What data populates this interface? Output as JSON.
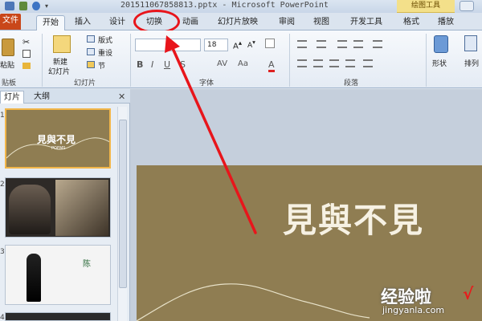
{
  "window": {
    "title": "201511067858813.pptx - Microsoft PowerPoint",
    "context_tool_title": "绘图工具"
  },
  "tabs": [
    {
      "label": "文件"
    },
    {
      "label": "开始"
    },
    {
      "label": "插入"
    },
    {
      "label": "设计"
    },
    {
      "label": "切换"
    },
    {
      "label": "动画"
    },
    {
      "label": "幻灯片放映"
    },
    {
      "label": "审阅"
    },
    {
      "label": "视图"
    },
    {
      "label": "开发工具"
    },
    {
      "label": "格式"
    },
    {
      "label": "播放"
    }
  ],
  "ribbon": {
    "clipboard": {
      "paste_label": "粘贴",
      "group_label": "贴板"
    },
    "slides": {
      "new_slide_label": "新建",
      "new_slide_sub": "幻灯片",
      "layout_label": "版式",
      "reset_label": "重设",
      "section_label": "节",
      "group_label": "幻灯片"
    },
    "font": {
      "font_size": "18",
      "group_label": "字体"
    },
    "paragraph": {
      "group_label": "段落"
    },
    "drawing": {
      "shape_label": "形状",
      "arrange_label": "排列"
    }
  },
  "pane": {
    "tab_slides": "灯片",
    "tab_outline": "大纲",
    "thumbnails": [
      {
        "number": "1",
        "title": "見與不見",
        "subtitle": "POEMS"
      },
      {
        "number": "2"
      },
      {
        "number": "3",
        "title": "陈"
      },
      {
        "number": "4"
      }
    ]
  },
  "slide": {
    "title": "見與不見"
  },
  "watermark": {
    "text": "经验啦",
    "check": "√",
    "url": "jingyanla.com"
  },
  "colors": {
    "file_tab": "#c9471a",
    "highlight": "#e8151b",
    "slide_background": "#8f7d52"
  }
}
